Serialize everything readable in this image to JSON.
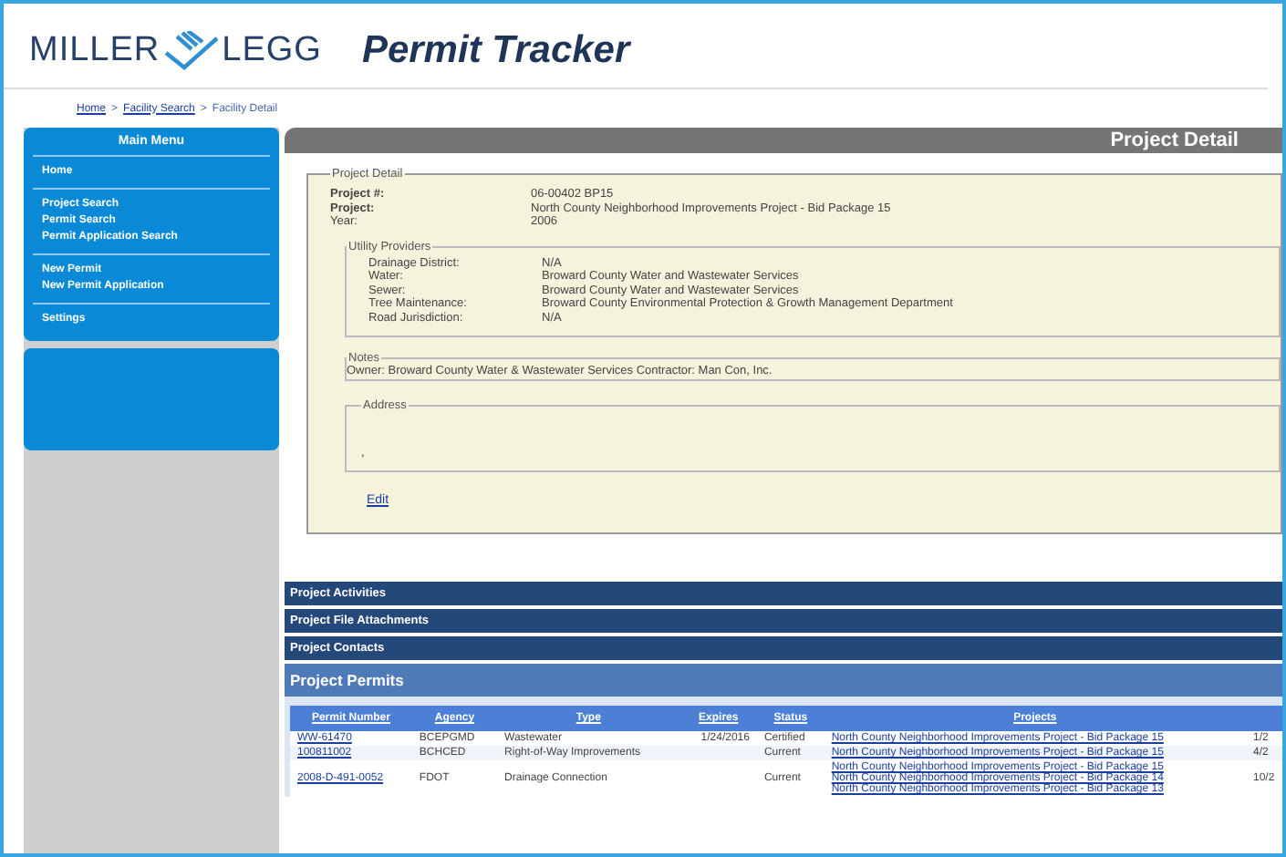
{
  "header": {
    "logo_left": "MILLER",
    "logo_right": "LEGG",
    "title": "Permit Tracker"
  },
  "breadcrumb_separator": ">",
  "breadcrumb": [
    {
      "label": "Home",
      "link": true
    },
    {
      "label": "Facility Search",
      "link": true
    },
    {
      "label": "Facility Detail",
      "link": false
    }
  ],
  "sidebar": {
    "title": "Main Menu",
    "groups": [
      [
        "Home"
      ],
      [
        "Project Search",
        "Permit Search",
        "Permit Application Search"
      ],
      [
        "New Permit",
        "New Permit Application"
      ],
      [
        "Settings"
      ]
    ]
  },
  "page_title": "Project Detail",
  "project_detail": {
    "legend": "Project Detail",
    "fields": [
      {
        "label": "Project #:",
        "value": "06-00402 BP15",
        "bold": true
      },
      {
        "label": "Project:",
        "value": "North County Neighborhood Improvements Project - Bid Package 15",
        "bold": true
      },
      {
        "label": "Year:",
        "value": "2006",
        "bold": false
      }
    ],
    "utility_providers": {
      "legend": "Utility Providers",
      "fields": [
        {
          "label": "Drainage District:",
          "value": "N/A"
        },
        {
          "label": "Water:",
          "value": "Broward County Water and Wastewater Services"
        },
        {
          "label": "Sewer:",
          "value": "Broward County Water and Wastewater Services"
        },
        {
          "label": "Tree Maintenance:",
          "value": "Broward County Environmental Protection & Growth Management Department"
        },
        {
          "label": "Road Jurisdiction:",
          "value": "N/A"
        }
      ]
    },
    "notes": {
      "legend": "Notes",
      "value": "Owner: Broward County Water & Wastewater Services Contractor: Man Con, Inc."
    },
    "address": {
      "legend": "Address",
      "value": ","
    },
    "edit_link": "Edit"
  },
  "sections": [
    {
      "title": "Project Activities",
      "expanded": false
    },
    {
      "title": "Project File Attachments",
      "expanded": false
    },
    {
      "title": "Project Contacts",
      "expanded": false
    },
    {
      "title": "Project Permits",
      "expanded": true
    }
  ],
  "permits_table": {
    "columns": [
      "Permit Number",
      "Agency",
      "Type",
      "Expires",
      "Status",
      "Projects"
    ],
    "rows": [
      {
        "permit_number": "WW-61470",
        "agency": "BCEPGMD",
        "type": "Wastewater",
        "expires": "1/24/2016",
        "status": "Certified",
        "projects": [
          "North County Neighborhood Improvements Project - Bid Package 15"
        ],
        "column_7": "1/2"
      },
      {
        "permit_number": "100811002",
        "agency": "BCHCED",
        "type": "Right-of-Way Improvements",
        "expires": "",
        "status": "Current",
        "projects": [
          "North County Neighborhood Improvements Project - Bid Package 15"
        ],
        "column_7": "4/2"
      },
      {
        "permit_number": "2008-D-491-0052",
        "agency": "FDOT",
        "type": "Drainage Connection",
        "expires": "",
        "status": "Current",
        "projects": [
          "North County Neighborhood Improvements Project - Bid Package 15",
          "North County Neighborhood Improvements Project - Bid Package 14",
          "North County Neighborhood Improvements Project - Bid Package 13"
        ],
        "column_7": "10/2"
      }
    ]
  }
}
